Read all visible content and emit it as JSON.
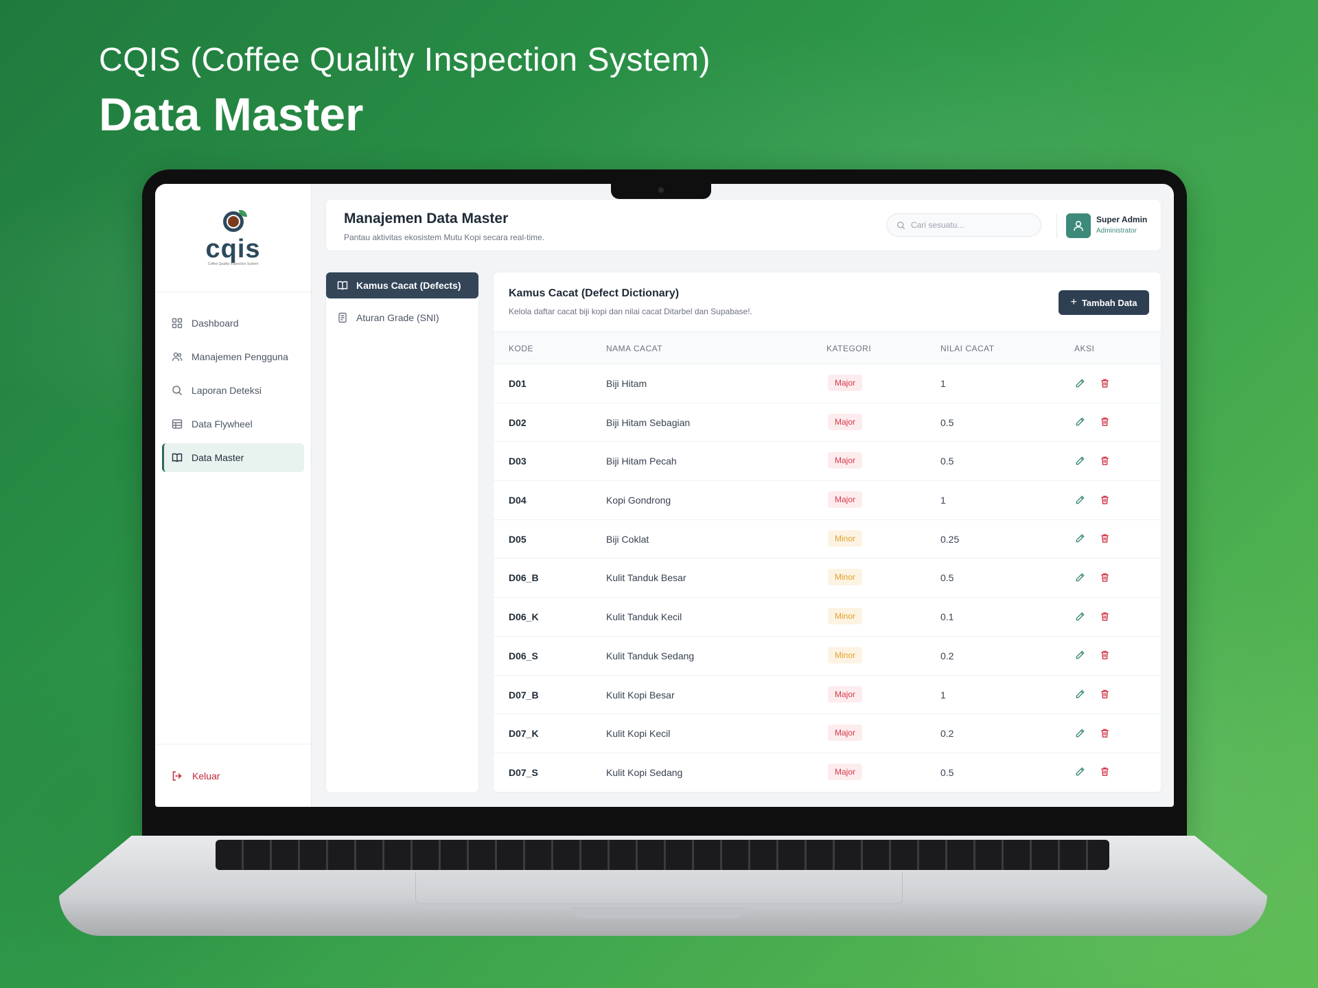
{
  "hero": {
    "subtitle": "CQIS (Coffee Quality Inspection System)",
    "title": "Data Master"
  },
  "logo": {
    "text": "cqis",
    "tagline": "Coffee Quality Inspection System"
  },
  "sidebar": {
    "items": [
      {
        "label": "Dashboard",
        "icon": "grid-icon",
        "active": false
      },
      {
        "label": "Manajemen Pengguna",
        "icon": "users-icon",
        "active": false
      },
      {
        "label": "Laporan Deteksi",
        "icon": "search-icon",
        "active": false
      },
      {
        "label": "Data Flywheel",
        "icon": "table-icon",
        "active": false
      },
      {
        "label": "Data Master",
        "icon": "book-icon",
        "active": true
      }
    ],
    "logout": "Keluar"
  },
  "header": {
    "title": "Manajemen Data Master",
    "subtitle": "Pantau aktivitas ekosistem Mutu Kopi secara real-time.",
    "search_placeholder": "Cari sesuatu...",
    "user_name": "Super Admin",
    "user_role": "Administrator"
  },
  "subnav": {
    "items": [
      {
        "label": "Kamus Cacat (Defects)",
        "icon": "book-icon",
        "active": true
      },
      {
        "label": "Aturan Grade (SNI)",
        "icon": "document-icon",
        "active": false
      }
    ]
  },
  "card": {
    "title": "Kamus Cacat (Defect Dictionary)",
    "subtitle": "Kelola daftar cacat biji kopi dan nilai cacat Ditarbel dan Supabase!.",
    "add_button": "Tambah Data"
  },
  "table": {
    "headers": [
      "KODE",
      "NAMA CACAT",
      "KATEGORI",
      "NILAI CACAT",
      "AKSI"
    ],
    "rows": [
      {
        "kode": "D01",
        "nama": "Biji Hitam",
        "kategori": "Major",
        "nilai": "1"
      },
      {
        "kode": "D02",
        "nama": "Biji Hitam Sebagian",
        "kategori": "Major",
        "nilai": "0.5"
      },
      {
        "kode": "D03",
        "nama": "Biji Hitam Pecah",
        "kategori": "Major",
        "nilai": "0.5"
      },
      {
        "kode": "D04",
        "nama": "Kopi Gondrong",
        "kategori": "Major",
        "nilai": "1"
      },
      {
        "kode": "D05",
        "nama": "Biji Coklat",
        "kategori": "Minor",
        "nilai": "0.25"
      },
      {
        "kode": "D06_B",
        "nama": "Kulit Tanduk Besar",
        "kategori": "Minor",
        "nilai": "0.5"
      },
      {
        "kode": "D06_K",
        "nama": "Kulit Tanduk Kecil",
        "kategori": "Minor",
        "nilai": "0.1"
      },
      {
        "kode": "D06_S",
        "nama": "Kulit Tanduk Sedang",
        "kategori": "Minor",
        "nilai": "0.2"
      },
      {
        "kode": "D07_B",
        "nama": "Kulit Kopi Besar",
        "kategori": "Major",
        "nilai": "1"
      },
      {
        "kode": "D07_K",
        "nama": "Kulit Kopi Kecil",
        "kategori": "Major",
        "nilai": "0.2"
      },
      {
        "kode": "D07_S",
        "nama": "Kulit Kopi Sedang",
        "kategori": "Major",
        "nilai": "0.5"
      }
    ]
  },
  "colors": {
    "accent_dark": "#2f3f52",
    "brand_teal": "#3d8a7a",
    "major": "#d23a4a",
    "minor": "#e0a22a",
    "danger": "#c0263a"
  }
}
